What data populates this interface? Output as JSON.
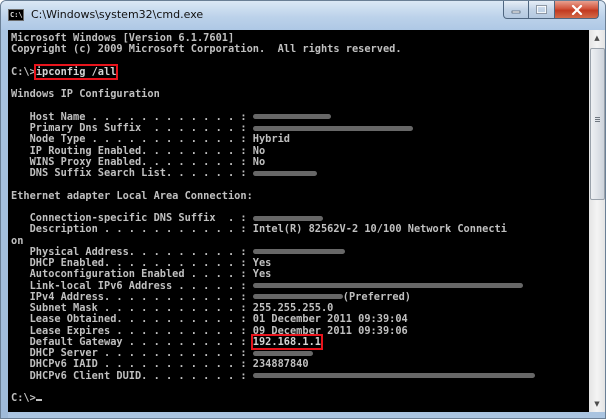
{
  "window": {
    "title": "C:\\Windows\\system32\\cmd.exe",
    "icon": "cmd-icon",
    "icon_glyph": "C:\\"
  },
  "controls": {
    "minimize": "minimize-icon",
    "maximize": "maximize-icon",
    "close": "close-icon"
  },
  "console": {
    "lines": {
      "banner1": "Microsoft Windows [Version 6.1.7601]",
      "banner2": "Copyright (c) 2009 Microsoft Corporation.  All rights reserved.",
      "prompt1": "C:\\>",
      "command": "ipconfig /all",
      "win_ip_header": "Windows IP Configuration",
      "host_name": "   Host Name . . . . . . . . . . . . : ",
      "primary_dns": "   Primary Dns Suffix  . . . . . . . : ",
      "node_type": "   Node Type . . . . . . . . . . . . : Hybrid",
      "ip_routing": "   IP Routing Enabled. . . . . . . . : No",
      "wins_proxy": "   WINS Proxy Enabled. . . . . . . . : No",
      "dns_search": "   DNS Suffix Search List. . . . . . : ",
      "ethernet_header": "Ethernet adapter Local Area Connection:",
      "conn_dns": "   Connection-specific DNS Suffix  . : ",
      "description": "   Description . . . . . . . . . . . : Intel(R) 82562V-2 10/100 Network Connecti",
      "description_wrap": "on",
      "physical": "   Physical Address. . . . . . . . . : ",
      "dhcp_enabled": "   DHCP Enabled. . . . . . . . . . . : Yes",
      "autoconfig": "   Autoconfiguration Enabled . . . . : Yes",
      "link_local": "   Link-local IPv6 Address . . . . . : ",
      "ipv4_label": "   IPv4 Address. . . . . . . . . . . : ",
      "ipv4_suffix": "(Preferred)",
      "subnet": "   Subnet Mask . . . . . . . . . . . : 255.255.255.0",
      "lease_obtained": "   Lease Obtained. . . . . . . . . . : 01 December 2011 09:39:04",
      "lease_expires": "   Lease Expires . . . . . . . . . . : 09 December 2011 09:39:06",
      "gateway_label": "   Default Gateway . . . . . . . . . : ",
      "gateway_value": "192.168.1.1",
      "dhcp_server": "   DHCP Server . . . . . . . . . . . : ",
      "dhcpv6_iaid": "   DHCPv6 IAID . . . . . . . . . . . : 234887840",
      "dhcpv6_duid": "   DHCPv6 Client DUID. . . . . . . . : ",
      "prompt2": "C:\\>"
    }
  },
  "scrollbar": {
    "up_icon": "scroll-up-arrow-icon",
    "down_icon": "scroll-down-arrow-icon",
    "up_glyph": "▲",
    "down_glyph": "▼"
  }
}
